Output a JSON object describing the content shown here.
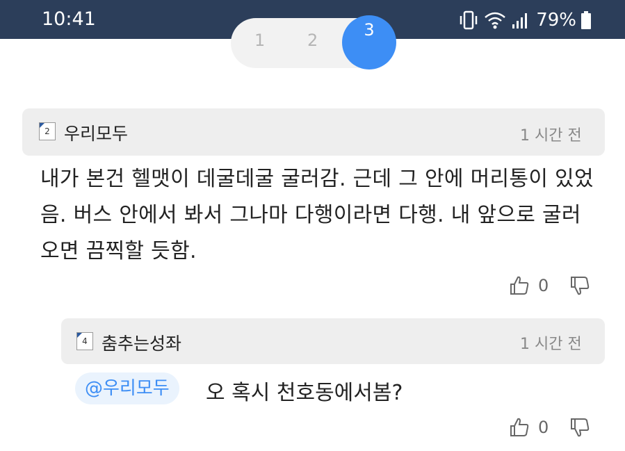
{
  "status_bar": {
    "time": "10:41",
    "battery": "79%"
  },
  "pager": {
    "pages": [
      "1",
      "2",
      "3"
    ],
    "current": "3"
  },
  "comment": {
    "level": "2",
    "author": "우리모두",
    "time": "1 시간 전",
    "body": "내가 본건 헬맷이 데굴데굴 굴러감. 근데 그 안에 머리통이 있었음. 버스 안에서 봐서 그나마 다행이라면 다행. 내 앞으로 굴러오면 끔찍할 듯함.",
    "likes": "0"
  },
  "reply": {
    "level": "4",
    "author": "춤추는성좌",
    "time": "1 시간 전",
    "mention": "@우리모두",
    "body": "오 혹시 천호동에서봄?",
    "likes": "0"
  },
  "icons": [
    "vibrate-icon",
    "wifi-icon",
    "signal-icon",
    "battery-icon",
    "thumbs-up-icon",
    "thumbs-down-icon"
  ],
  "colors": {
    "status_bar": "#2c3e5a",
    "accent": "#3d8ef5",
    "header_bg": "#eeeeee",
    "mention_bg": "#eaf3fd"
  }
}
